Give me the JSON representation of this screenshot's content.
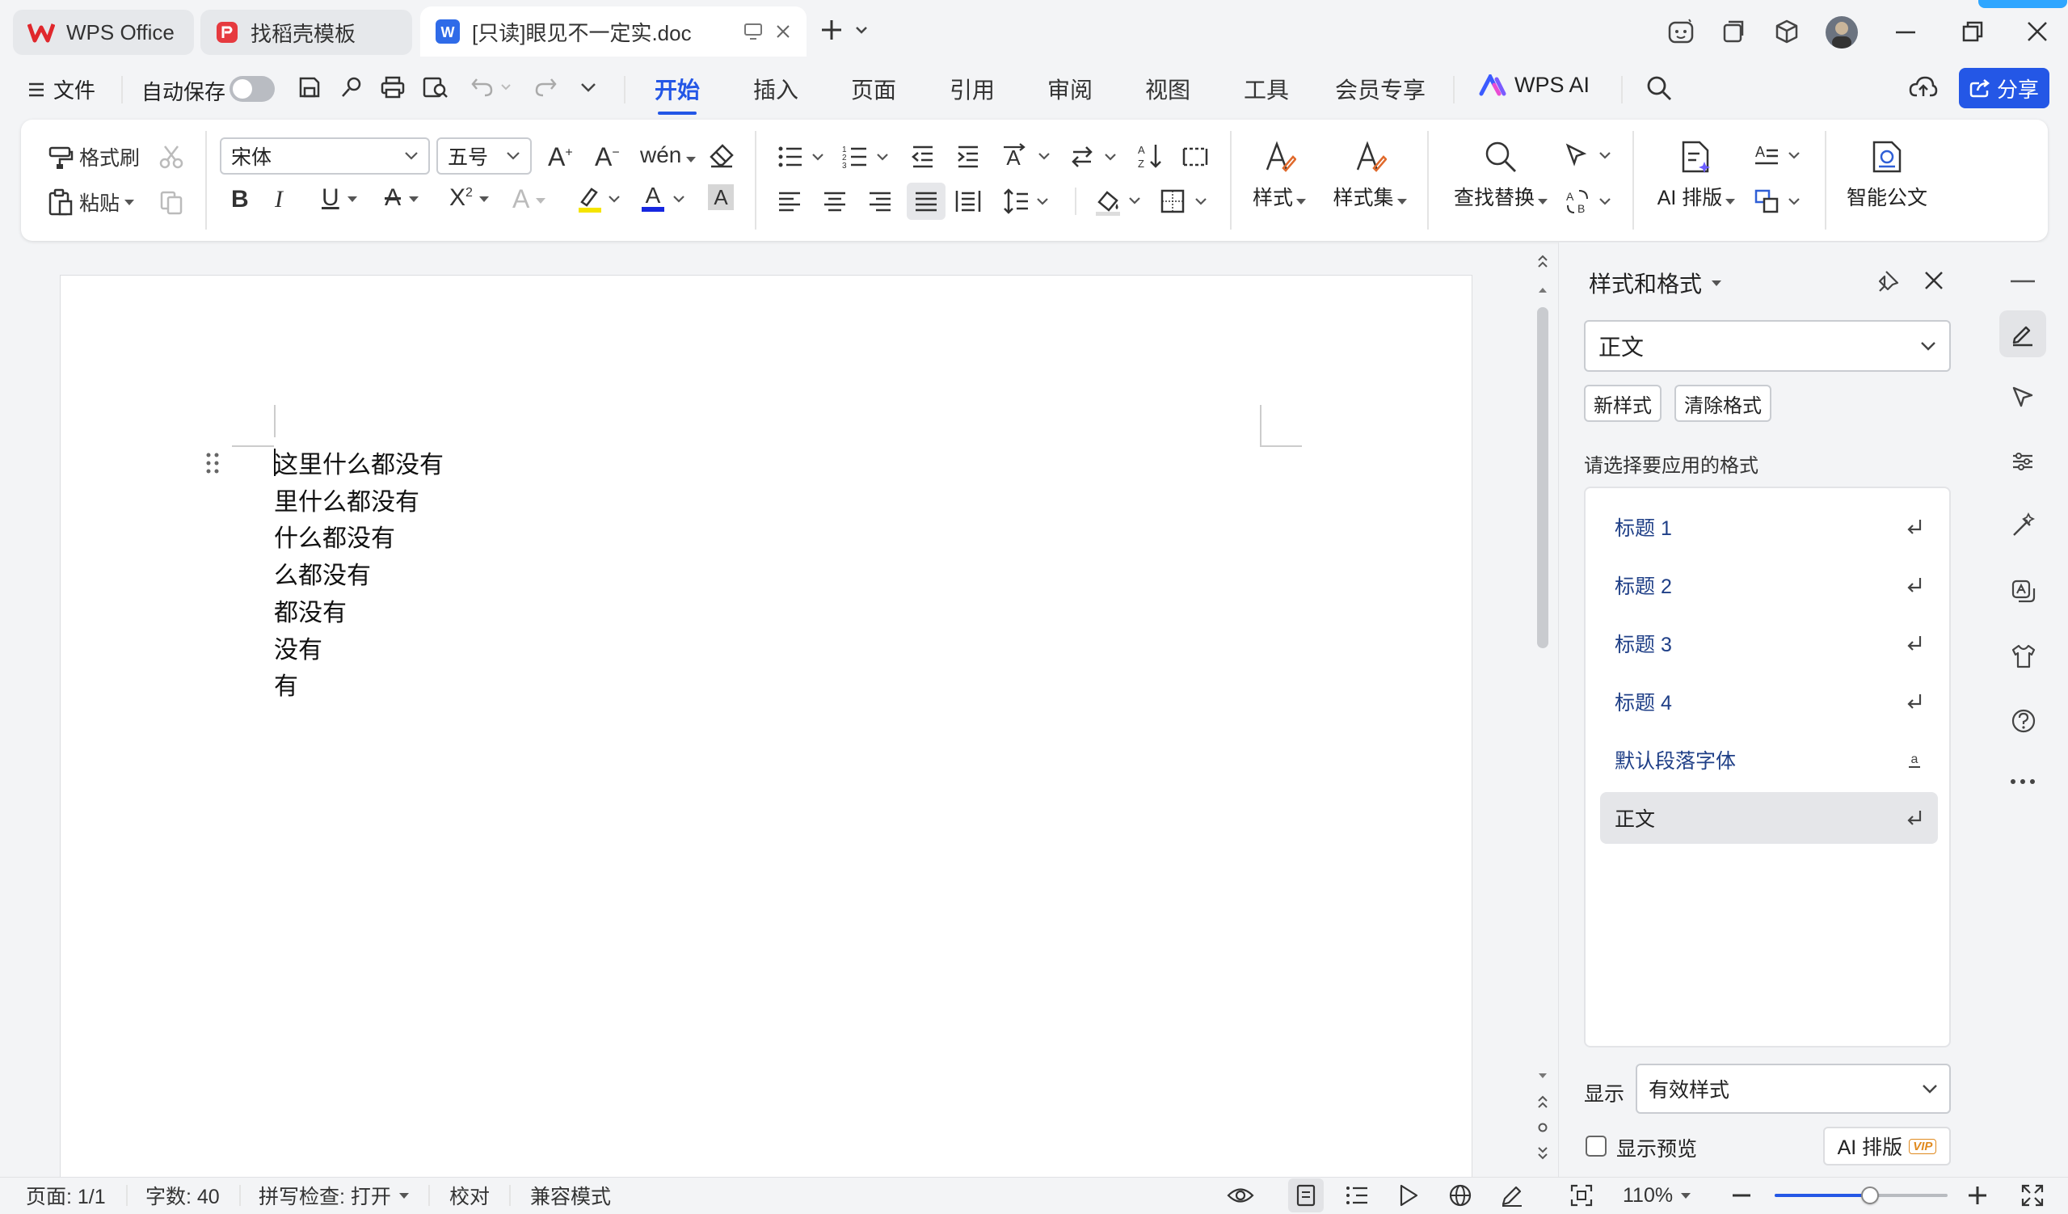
{
  "tabs": [
    {
      "label": "WPS Office"
    },
    {
      "label": "找稻壳模板"
    },
    {
      "label": "[只读]眼见不一定实.doc"
    }
  ],
  "menu": {
    "file_label": "文件",
    "autosave_label": "自动保存",
    "items": [
      "开始",
      "插入",
      "页面",
      "引用",
      "审阅",
      "视图",
      "工具",
      "会员专享"
    ],
    "ai_label": "WPS AI",
    "share_label": "分享"
  },
  "ribbon": {
    "format_brush": "格式刷",
    "paste": "粘贴",
    "font_name": "宋体",
    "font_size": "五号",
    "style": "样式",
    "style_set": "样式集",
    "find_replace": "查找替换",
    "ai_layout": "AI 排版",
    "smart_doc": "智能公文"
  },
  "document": {
    "lines": [
      "这里什么都没有",
      "里什么都没有",
      "什么都没有",
      "么都没有",
      "都没有",
      "没有",
      "有"
    ]
  },
  "panel": {
    "title": "样式和格式",
    "current_style": "正文",
    "new_style": "新样式",
    "clear_format": "清除格式",
    "prompt": "请选择要应用的格式",
    "styles": [
      "标题 1",
      "标题 2",
      "标题 3",
      "标题 4",
      "默认段落字体",
      "正文"
    ],
    "selected_style": "正文",
    "show_label": "显示",
    "show_value": "有效样式",
    "preview_label": "显示预览",
    "ai_layout_button": "AI 排版",
    "vip_badge": "VIP"
  },
  "status": {
    "page": "页面: 1/1",
    "words": "字数: 40",
    "spell": "拼写检查: 打开",
    "proof": "校对",
    "compat": "兼容模式",
    "zoom": "110%",
    "zoom_level": 0.55
  },
  "colors": {
    "accent": "#2457e6",
    "brand_red": "#e0272c",
    "word_blue": "#2f6be8"
  },
  "icons": [
    "wps-logo-icon",
    "docer-icon",
    "word-icon",
    "search-icon",
    "cloud-upload-icon",
    "share-icon",
    "pen-icon",
    "cursor-icon",
    "sliders-icon",
    "magic-icon",
    "translate-icon",
    "shirt-icon",
    "help-icon",
    "more-icon"
  ]
}
